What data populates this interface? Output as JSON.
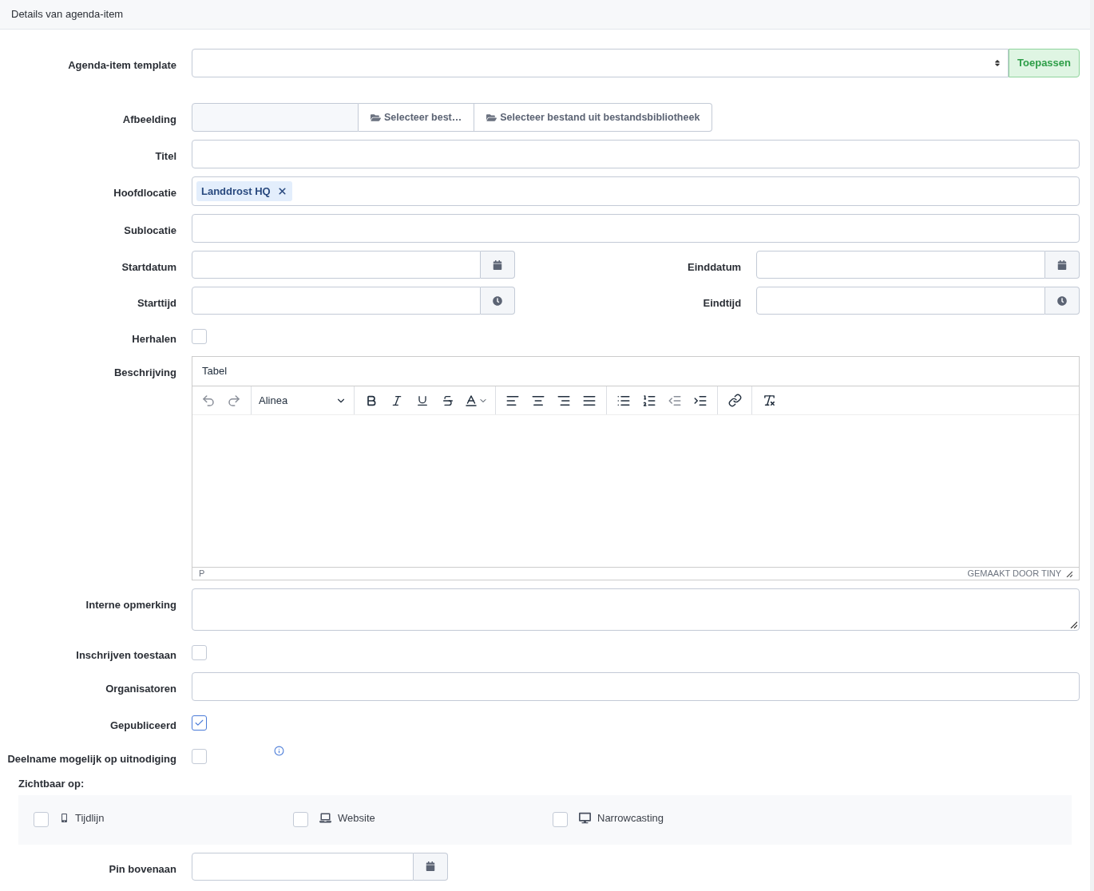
{
  "header": {
    "title": "Details van agenda-item"
  },
  "fields": [
    {
      "kind": "select",
      "label": "Agenda-item template",
      "button": "Toepassen"
    },
    {
      "kind": "file",
      "label": "Afbeelding",
      "buttons": [
        "Selecteer best…",
        "Selecteer bestand uit bestandsbibliotheek"
      ]
    },
    {
      "kind": "text",
      "label": "Titel"
    },
    {
      "kind": "tags",
      "label": "Hoofdlocatie",
      "tags": [
        {
          "label": "Landdrost HQ"
        }
      ]
    },
    {
      "kind": "text",
      "label": "Sublocatie"
    },
    {
      "kind": "pair",
      "items": [
        {
          "kind": "date",
          "label": "Startdatum"
        },
        {
          "kind": "date",
          "label": "Einddatum"
        }
      ]
    },
    {
      "kind": "pair",
      "items": [
        {
          "kind": "time",
          "label": "Starttijd"
        },
        {
          "kind": "time",
          "label": "Eindtijd"
        }
      ]
    },
    {
      "kind": "checkbox",
      "label": "Herhalen",
      "checked": false
    },
    {
      "kind": "editor",
      "label": "Beschrijving",
      "menubar": [
        "Tabel"
      ],
      "block_format": "Alinea",
      "path": "P",
      "branding": "GEMAAKT DOOR TINY"
    },
    {
      "kind": "textarea",
      "label": "Interne opmerking"
    },
    {
      "kind": "checkbox",
      "label": "Inschrijven toestaan",
      "checked": false
    },
    {
      "kind": "text",
      "label": "Organisatoren"
    },
    {
      "kind": "checkbox",
      "label": "Gepubliceerd",
      "checked": true
    },
    {
      "kind": "checkbox",
      "label": "Deelname mogelijk op uitnodiging",
      "checked": false,
      "info": true
    },
    {
      "kind": "visibility",
      "label": "Zichtbaar op:",
      "options": [
        {
          "kind": "phone",
          "label": "Tijdlijn",
          "checked": false
        },
        {
          "kind": "laptop",
          "label": "Website",
          "checked": false
        },
        {
          "kind": "monitor",
          "label": "Narrowcasting",
          "checked": false
        }
      ]
    },
    {
      "kind": "date",
      "label": "Pin bovenaan"
    }
  ]
}
